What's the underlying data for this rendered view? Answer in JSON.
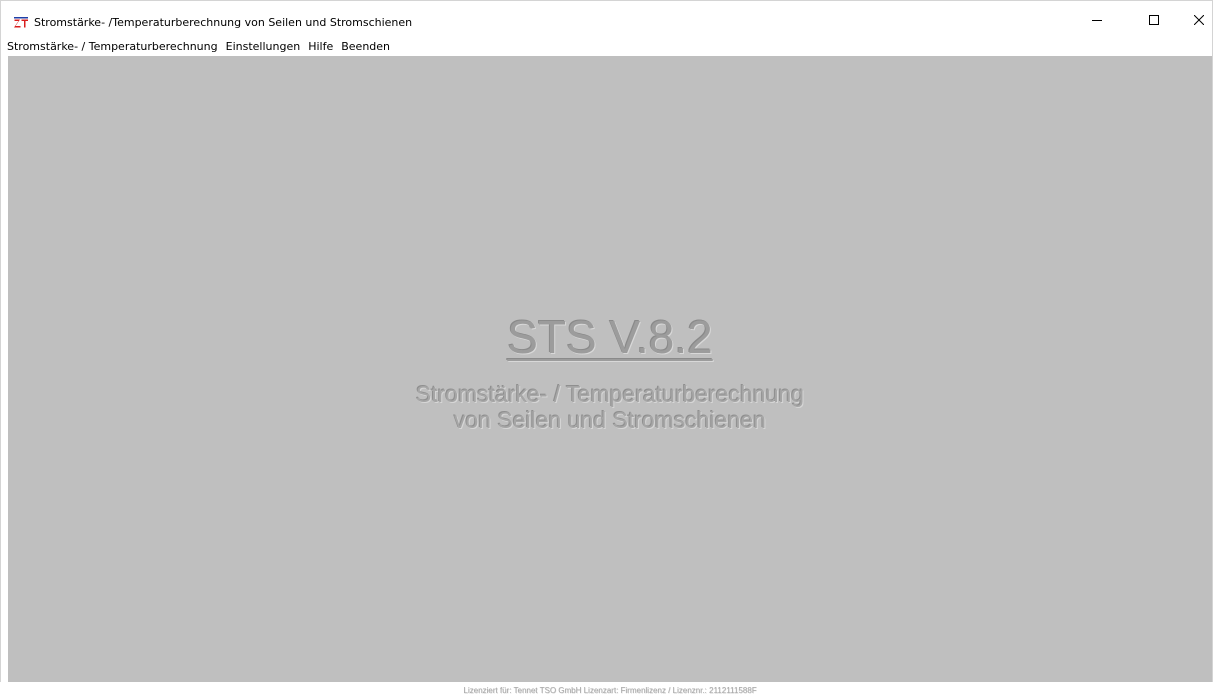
{
  "window": {
    "title": "Stromstärke- /Temperaturberechnung von Seilen und Stromschienen",
    "icon": "zt-app-icon",
    "controls": {
      "minimize": "minimize-icon",
      "maximize": "maximize-icon",
      "close": "close-icon"
    }
  },
  "menubar": {
    "items": [
      {
        "label": "Stromstärke- / Temperaturberechnung"
      },
      {
        "label": "Einstellungen"
      },
      {
        "label": "Hilfe"
      },
      {
        "label": "Beenden"
      }
    ]
  },
  "splash": {
    "product": "STS V.8.2",
    "subtitle_line1": "Stromstärke- / Temperaturberechnung",
    "subtitle_line2": "von Seilen und Stromschienen",
    "license": "Lizenziert für: Tennet TSO GmbH Lizenzart: Firmenlizenz / Lizenznr.: 2112111588F"
  },
  "colors": {
    "client_background": "#bfbfbf",
    "splash_text": "#9c9c9c"
  }
}
